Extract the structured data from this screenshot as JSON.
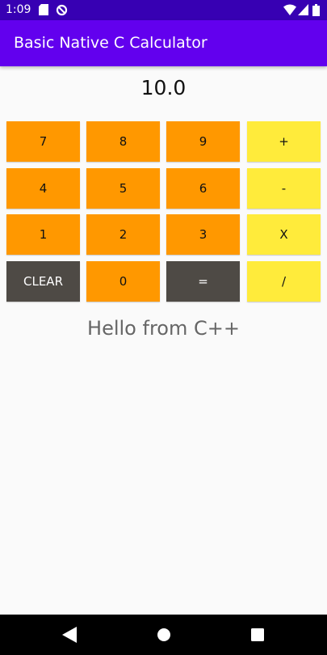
{
  "status_bar": {
    "time": "1:09",
    "icons": [
      "sd-card-icon",
      "data-saver-icon",
      "wifi-icon",
      "cellular-signal-icon",
      "battery-icon"
    ]
  },
  "app_bar": {
    "title": "Basic Native C Calculator"
  },
  "display": {
    "value": "10.0"
  },
  "keys": {
    "row1": [
      "7",
      "8",
      "9",
      "+"
    ],
    "row2": [
      "4",
      "5",
      "6",
      "-"
    ],
    "row3": [
      "1",
      "2",
      "3",
      "X"
    ],
    "row4": [
      "CLEAR",
      "0",
      "=",
      "/"
    ]
  },
  "colors": {
    "digit_key": "#ff9800",
    "operator_key": "#ffeb3b",
    "function_key": "#4e4a45",
    "app_bar": "#6200ee",
    "status_bar": "#3700b3"
  },
  "message": "Hello from C++",
  "nav_bar": {
    "icons": [
      "back-icon",
      "home-icon",
      "recents-icon"
    ]
  }
}
